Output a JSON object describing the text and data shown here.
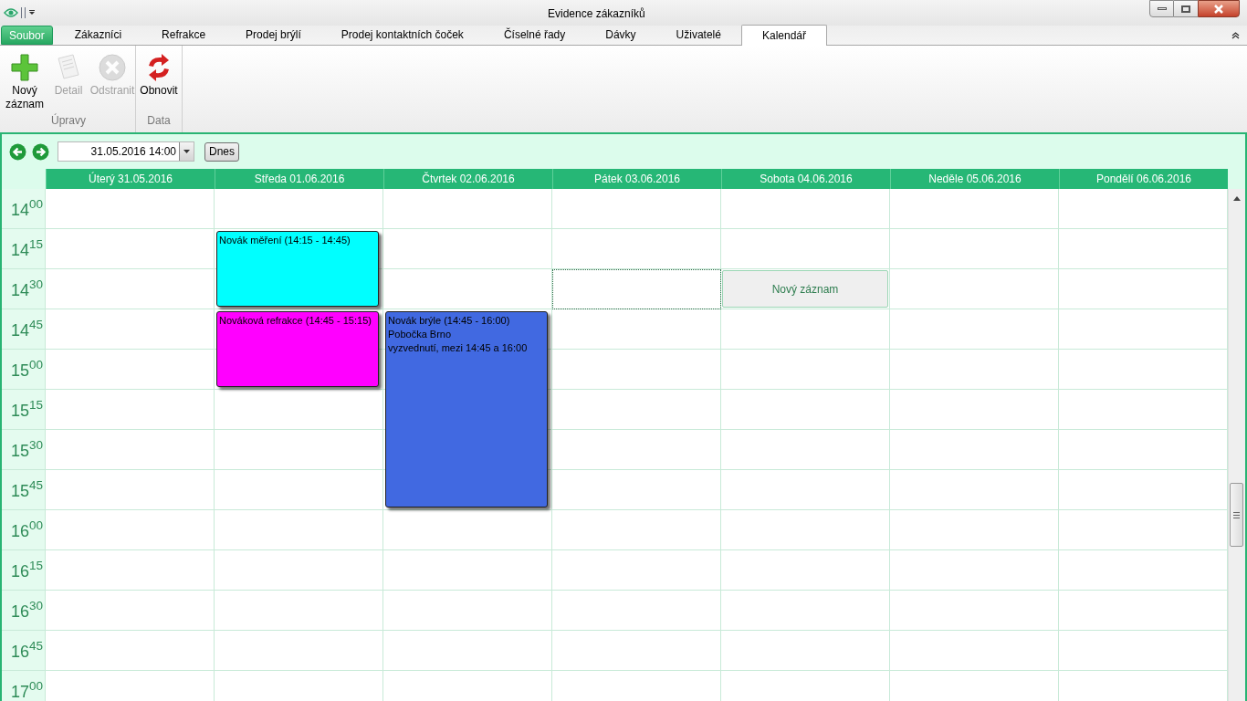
{
  "window": {
    "title": "Evidence zákazníků"
  },
  "tabs": [
    {
      "label": "Soubor",
      "kind": "file",
      "selected": false
    },
    {
      "label": "Zákazníci",
      "kind": "tab",
      "selected": false
    },
    {
      "label": "Refrakce",
      "kind": "tab",
      "selected": false
    },
    {
      "label": "Prodej brýlí",
      "kind": "tab",
      "selected": false
    },
    {
      "label": "Prodej kontaktních čoček",
      "kind": "tab",
      "selected": false
    },
    {
      "label": "Číselné řady",
      "kind": "tab",
      "selected": false
    },
    {
      "label": "Dávky",
      "kind": "tab",
      "selected": false
    },
    {
      "label": "Uživatelé",
      "kind": "tab",
      "selected": false
    },
    {
      "label": "Kalendář",
      "kind": "tab",
      "selected": true
    }
  ],
  "ribbon": {
    "groups": [
      {
        "label": "Úpravy",
        "buttons": [
          {
            "label": "Nový záznam",
            "kind": "add",
            "disabled": false
          },
          {
            "label": "Detail",
            "kind": "detail",
            "disabled": true
          },
          {
            "label": "Odstranit",
            "kind": "remove",
            "disabled": true
          }
        ]
      },
      {
        "label": "Data",
        "buttons": [
          {
            "label": "Obnovit",
            "kind": "reload",
            "disabled": false
          }
        ]
      }
    ]
  },
  "toolbar": {
    "date_value": "31.05.2016 14:00",
    "today_button": "Dnes"
  },
  "days": [
    {
      "label": "Úterý 31.05.2016"
    },
    {
      "label": "Středa 01.06.2016"
    },
    {
      "label": "Čtvrtek 02.06.2016"
    },
    {
      "label": "Pátek 03.06.2016"
    },
    {
      "label": "Sobota 04.06.2016"
    },
    {
      "label": "Neděle 05.06.2016"
    },
    {
      "label": "Pondělí 06.06.2016"
    }
  ],
  "time_rows": [
    {
      "hour": "14",
      "minute": "00",
      "cells": [
        {
          "selected": false
        },
        {
          "selected": false
        },
        {
          "selected": false
        },
        {
          "selected": false
        },
        {
          "selected": false
        },
        {
          "selected": false
        },
        {
          "selected": false
        }
      ]
    },
    {
      "hour": "14",
      "minute": "15",
      "cells": [
        {
          "selected": false
        },
        {
          "selected": false,
          "event": {
            "color": "#00ffff",
            "lines": [
              "Novák měření (14:15 - 14:45)"
            ]
          }
        },
        {
          "selected": false
        },
        {
          "selected": false
        },
        {
          "selected": false
        },
        {
          "selected": false
        },
        {
          "selected": false
        }
      ]
    },
    {
      "hour": "14",
      "minute": "30",
      "cells": [
        {
          "selected": false
        },
        {
          "covered": true
        },
        {
          "selected": false
        },
        {
          "selected": true
        },
        {
          "selected": false,
          "new_entry": "Nový záznam"
        },
        {
          "selected": false
        },
        {
          "selected": false
        }
      ]
    },
    {
      "hour": "14",
      "minute": "45",
      "cells": [
        {
          "selected": false
        },
        {
          "selected": false,
          "event": {
            "color": "#ff00ff",
            "lines": [
              "Nováková refrakce (14:45 - 15:15)"
            ]
          }
        },
        {
          "selected": false,
          "event": {
            "color": "#4169e1",
            "lines": [
              "Novák brýle (14:45 - 16:00)",
              "Pobočka Brno",
              "vyzvednutí, mezi 14:45 a 16:00"
            ]
          }
        },
        {
          "selected": false
        },
        {
          "selected": false
        },
        {
          "selected": false
        },
        {
          "selected": false
        }
      ]
    },
    {
      "hour": "15",
      "minute": "00",
      "cells": [
        {
          "selected": false
        },
        {
          "covered": true
        },
        {
          "covered": true
        },
        {
          "selected": false
        },
        {
          "selected": false
        },
        {
          "selected": false
        },
        {
          "selected": false
        }
      ]
    },
    {
      "hour": "15",
      "minute": "15",
      "cells": [
        {
          "selected": false
        },
        {
          "selected": false
        },
        {
          "covered": true
        },
        {
          "selected": false
        },
        {
          "selected": false
        },
        {
          "selected": false
        },
        {
          "selected": false
        }
      ]
    },
    {
      "hour": "15",
      "minute": "30",
      "cells": [
        {
          "selected": false
        },
        {
          "selected": false
        },
        {
          "covered": true
        },
        {
          "selected": false
        },
        {
          "selected": false
        },
        {
          "selected": false
        },
        {
          "selected": false
        }
      ]
    },
    {
      "hour": "15",
      "minute": "45",
      "cells": [
        {
          "selected": false
        },
        {
          "selected": false
        },
        {
          "covered": true
        },
        {
          "selected": false
        },
        {
          "selected": false
        },
        {
          "selected": false
        },
        {
          "selected": false
        }
      ]
    },
    {
      "hour": "16",
      "minute": "00",
      "cells": [
        {
          "selected": false
        },
        {
          "selected": false
        },
        {
          "selected": false
        },
        {
          "selected": false
        },
        {
          "selected": false
        },
        {
          "selected": false
        },
        {
          "selected": false
        }
      ]
    },
    {
      "hour": "16",
      "minute": "15",
      "cells": [
        {
          "selected": false
        },
        {
          "selected": false
        },
        {
          "selected": false
        },
        {
          "selected": false
        },
        {
          "selected": false
        },
        {
          "selected": false
        },
        {
          "selected": false
        }
      ]
    },
    {
      "hour": "16",
      "minute": "30",
      "cells": [
        {
          "selected": false
        },
        {
          "selected": false
        },
        {
          "selected": false
        },
        {
          "selected": false
        },
        {
          "selected": false
        },
        {
          "selected": false
        },
        {
          "selected": false
        }
      ]
    },
    {
      "hour": "16",
      "minute": "45",
      "cells": [
        {
          "selected": false
        },
        {
          "selected": false
        },
        {
          "selected": false
        },
        {
          "selected": false
        },
        {
          "selected": false
        },
        {
          "selected": false
        },
        {
          "selected": false
        }
      ]
    },
    {
      "hour": "17",
      "minute": "00",
      "cells": [
        {
          "selected": false
        },
        {
          "selected": false
        },
        {
          "selected": false
        },
        {
          "selected": false
        },
        {
          "selected": false
        },
        {
          "selected": false
        },
        {
          "selected": false
        }
      ]
    }
  ]
}
